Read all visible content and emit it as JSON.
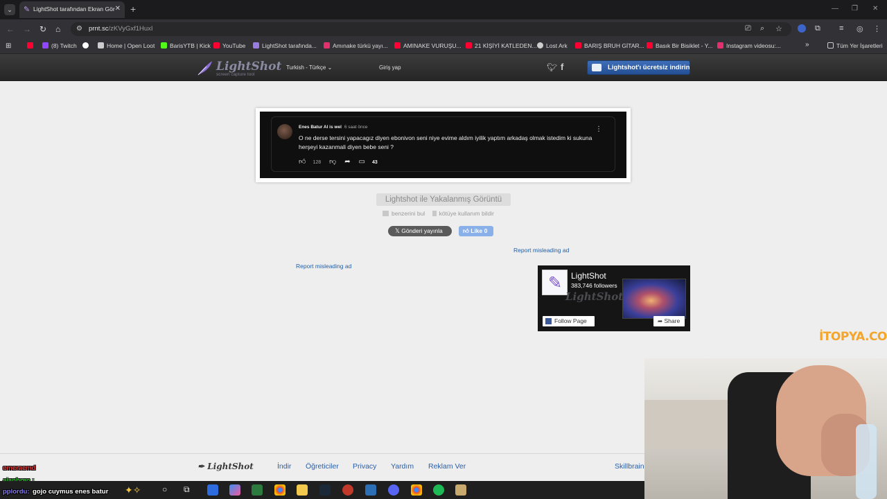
{
  "browser": {
    "tab_title": "LightShot tarafından Ekran Görüntüsü",
    "url_host": "prnt.sc",
    "url_path": "/zKVyGxf1HuxI",
    "bookmarks": [
      {
        "label": "",
        "color": "#ff0033"
      },
      {
        "label": "(8) Twitch",
        "color": "#9146ff"
      },
      {
        "label": "",
        "color": "#ffffff"
      },
      {
        "label": "Home | Open Loot",
        "color": "#cccccc"
      },
      {
        "label": "BarisYTB | Kick",
        "color": "#53fc18"
      },
      {
        "label": "YouTube",
        "color": "#ff0033"
      },
      {
        "label": "LightShot tarafında...",
        "color": "#9a7be0"
      },
      {
        "label": "Amınake türkü yayı...",
        "color": "#e1306c"
      },
      {
        "label": "AMINAKE VURUŞU...",
        "color": "#ff0033"
      },
      {
        "label": "21 KİŞİYİ KATLEDEN...",
        "color": "#ff0033"
      },
      {
        "label": "Lost Ark",
        "color": "#cccccc"
      },
      {
        "label": "BARIŞ BRUH GİTAR...",
        "color": "#ff0033"
      },
      {
        "label": "Basık Bir Bisiklet - Y...",
        "color": "#ff0033"
      },
      {
        "label": "Instagram videosu:...",
        "color": "#e1306c"
      }
    ],
    "all_bookmarks": "Tüm Yer İşaretleri"
  },
  "lightshot": {
    "logo": "LightShot",
    "logo_sub": "screen capture tool",
    "language": "Turkish - Türkçe",
    "login": "Giriş yap",
    "download": "Lightshot'ı ücretsiz indirin",
    "caption": "Lightshot ile Yakalanmış Görüntü",
    "find_similar": "benzerini bul",
    "report_abuse": "kötüye kullanım bildir",
    "tweet": "Gönderi yayınla",
    "like": "Like 0",
    "report_ad": "Report misleading ad"
  },
  "screenshot": {
    "author": "Enes Batur Al is wel",
    "time": "6 saat önce",
    "text": "O ne derse tersini yapacagız diyen ebonivon seni niye evime aldım iyilik yaptım arkadaş olmak istedim ki sukuna herşeyi kazanmali diyen bebe seni ?",
    "likes": "128",
    "replies": "43"
  },
  "facebook": {
    "name": "LightShot",
    "followers": "383,746 followers",
    "follow": "Follow Page",
    "share": "Share"
  },
  "footer": {
    "logo": "LightShot",
    "links": [
      "İndir",
      "Öğreticiler",
      "Privacy",
      "Yardım",
      "Reklam Ver",
      "Skillbrains"
    ]
  },
  "overlay": {
    "watermark": "İTOPYA.COM",
    "chat": [
      {
        "user": "emeraemd",
        "color": "#e33b3b"
      },
      {
        "user": "ajanbran :",
        "color": "#2ec22e"
      },
      {
        "user": "pplordu:",
        "color": "#8a7cf0",
        "message": "gojo cuymus enes batur"
      }
    ]
  }
}
